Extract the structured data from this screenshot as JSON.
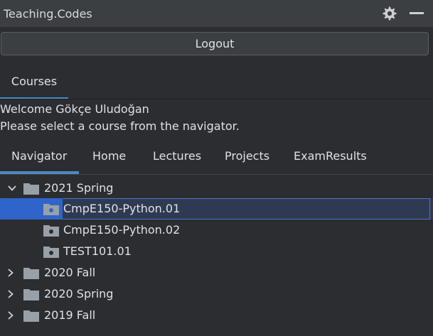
{
  "app": {
    "title": "Teaching.Codes"
  },
  "header": {
    "settings_icon": "gear-icon",
    "minimize_icon": "minimize-icon",
    "logout_label": "Logout"
  },
  "courses_tab": {
    "label": "Courses"
  },
  "welcome": {
    "line1": "Welcome Gökçe Uludoğan",
    "line2": "Please select a course from the navigator."
  },
  "tabs": [
    "Navigator",
    "Home",
    "Lectures",
    "Projects",
    "ExamResults"
  ],
  "tree": [
    {
      "label": "2021 Spring",
      "type": "folder",
      "expanded": true,
      "children": [
        {
          "label": "CmpE150-Python.01",
          "type": "course",
          "selected": true
        },
        {
          "label": "CmpE150-Python.02",
          "type": "course"
        },
        {
          "label": "TEST101.01",
          "type": "course"
        }
      ]
    },
    {
      "label": "2020 Fall",
      "type": "folder",
      "expanded": false
    },
    {
      "label": "2020 Spring",
      "type": "folder",
      "expanded": false
    },
    {
      "label": "2019 Fall",
      "type": "folder",
      "expanded": false
    }
  ],
  "colors": {
    "accent": "#4a88c7",
    "selection": "#2f65ca",
    "background": "#2b2d30"
  }
}
